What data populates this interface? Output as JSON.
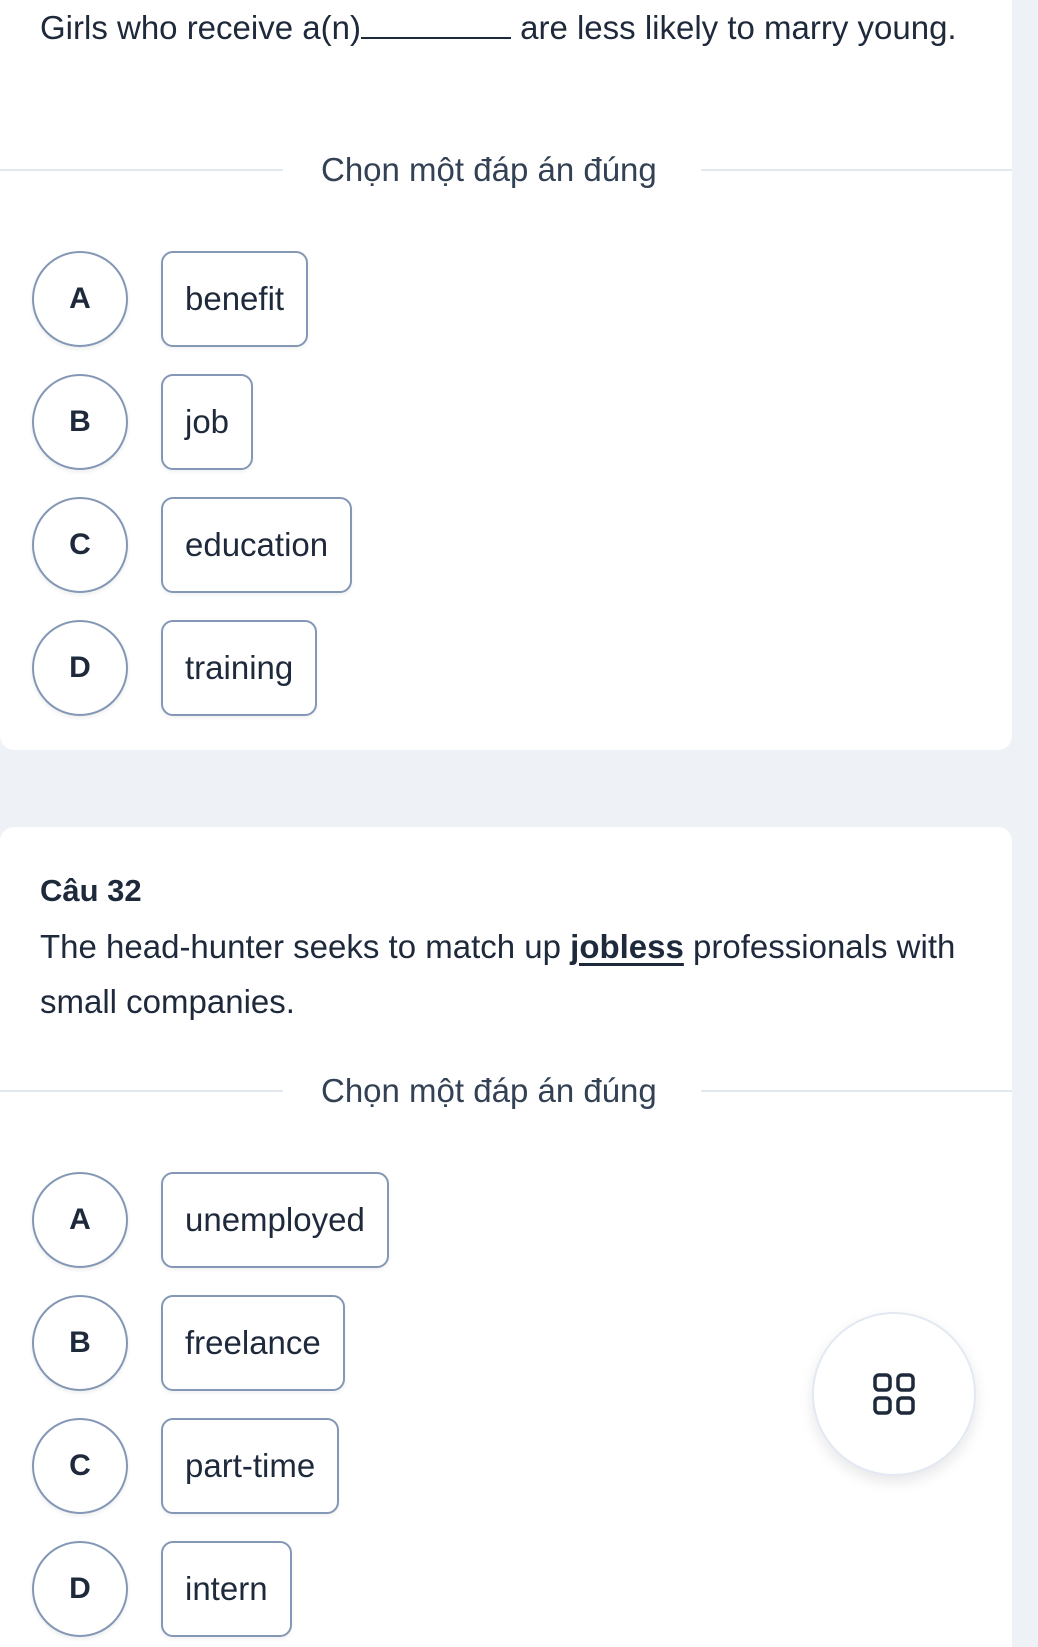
{
  "questions": [
    {
      "title": "",
      "text_before": "Girls who receive a(n)",
      "text_after": " are less likely to marry young.",
      "instruction": "Chọn một đáp án đúng",
      "options": [
        {
          "letter": "A",
          "text": "benefit"
        },
        {
          "letter": "B",
          "text": "job"
        },
        {
          "letter": "C",
          "text": "education"
        },
        {
          "letter": "D",
          "text": "training"
        }
      ]
    },
    {
      "title": "Câu 32",
      "text_before": "The head-hunter seeks to match up ",
      "underlined": "jobless",
      "text_after": " professionals with small companies.",
      "instruction": "Chọn một đáp án đúng",
      "options": [
        {
          "letter": "A",
          "text": "unemployed"
        },
        {
          "letter": "B",
          "text": "freelance"
        },
        {
          "letter": "C",
          "text": "part-time"
        },
        {
          "letter": "D",
          "text": "intern"
        }
      ]
    }
  ],
  "fab": {
    "icon": "grid-icon"
  }
}
